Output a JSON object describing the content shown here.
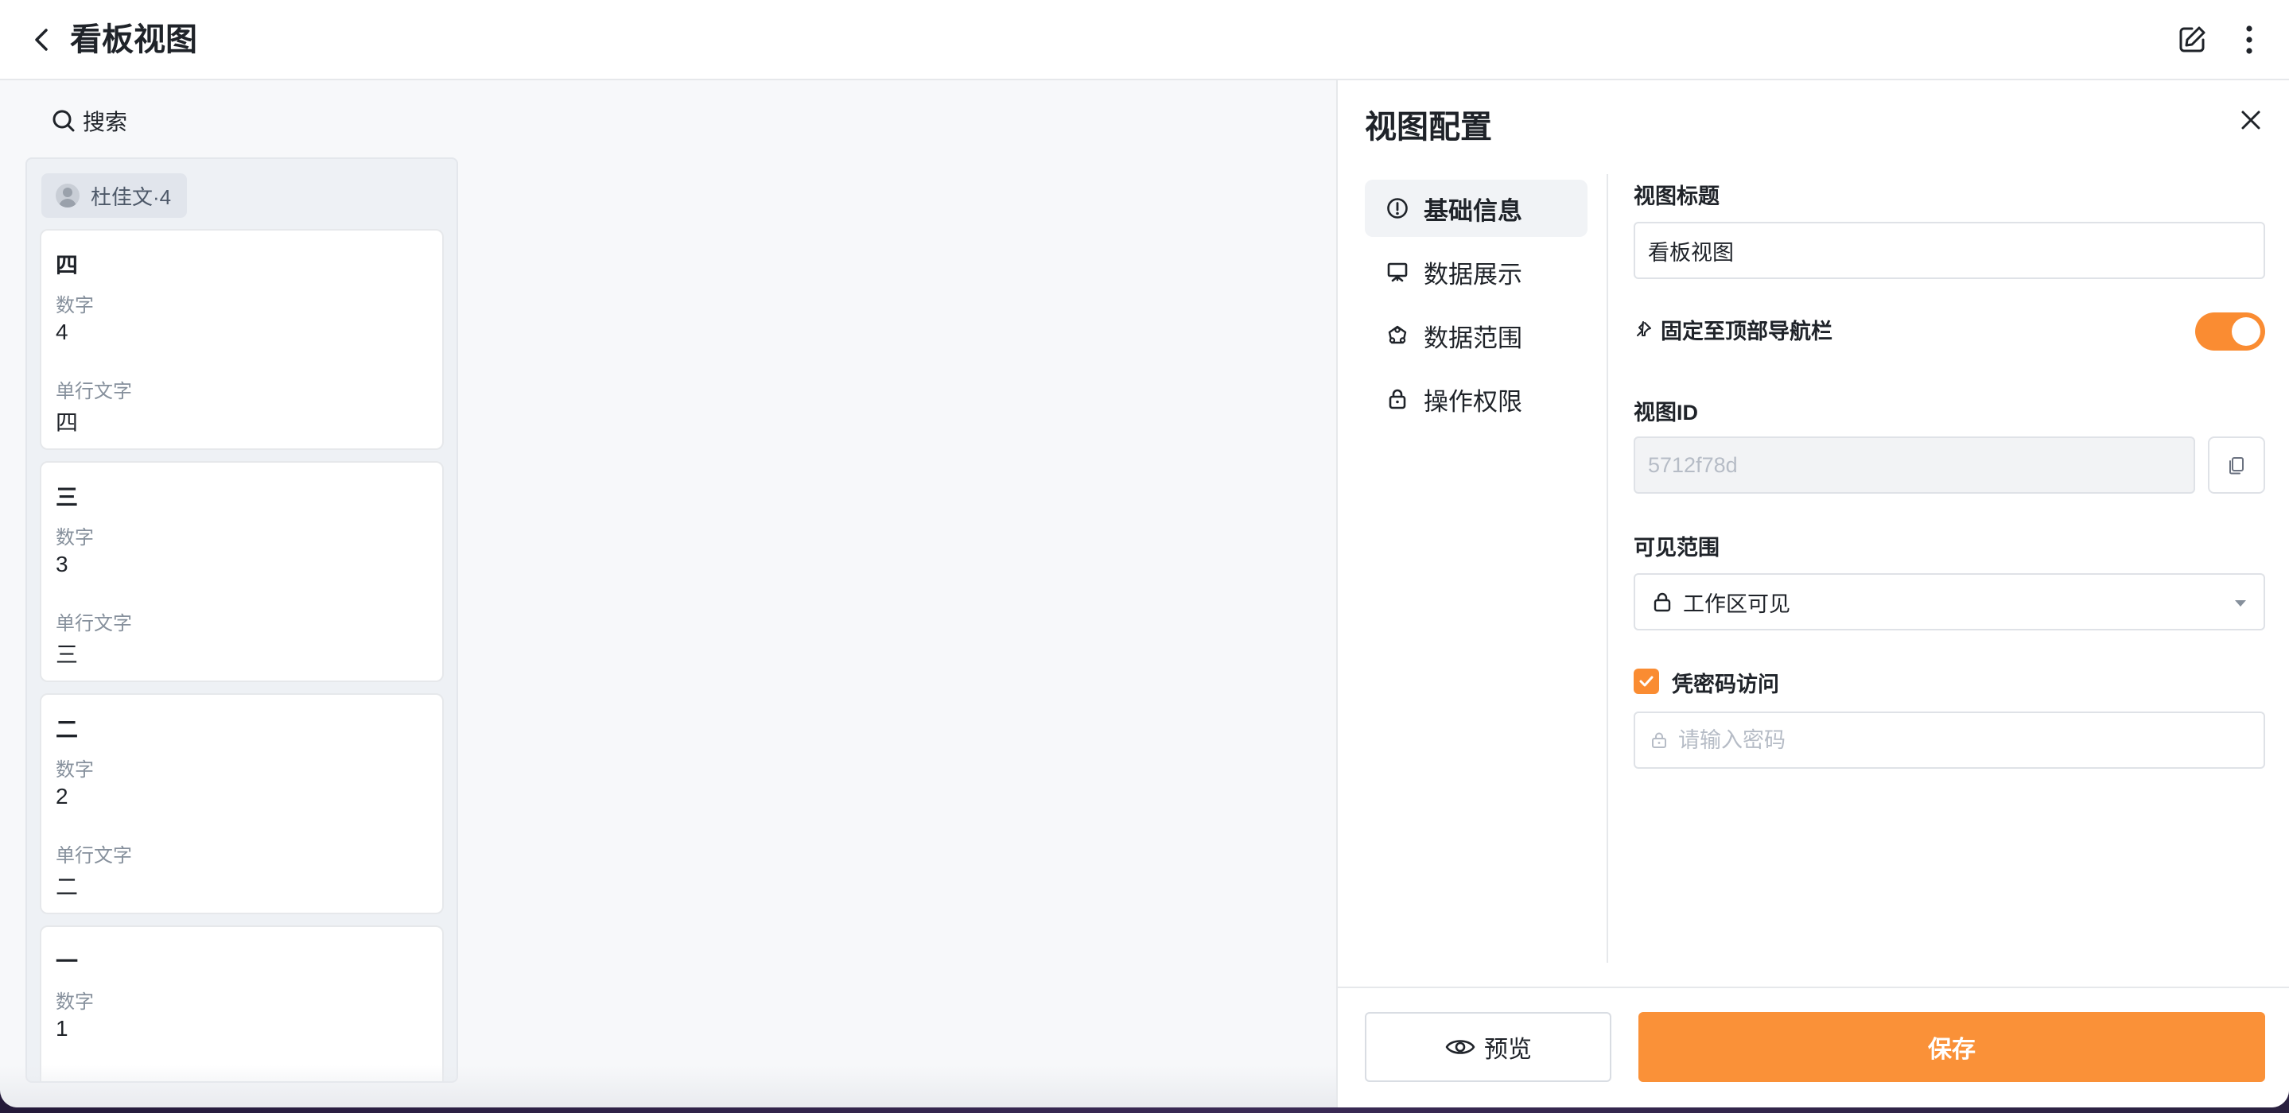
{
  "header": {
    "title": "看板视图",
    "back_icon": "chevron-left-icon",
    "edit_icon": "edit-icon",
    "more_icon": "more-vertical-icon"
  },
  "board": {
    "search_label": "搜索",
    "group": {
      "name": "杜佳文·4"
    },
    "cards": [
      {
        "title": "四",
        "fields": [
          {
            "label": "数字",
            "value": "4"
          },
          {
            "label": "单行文字",
            "value": "四"
          }
        ]
      },
      {
        "title": "三",
        "fields": [
          {
            "label": "数字",
            "value": "3"
          },
          {
            "label": "单行文字",
            "value": "三"
          }
        ]
      },
      {
        "title": "二",
        "fields": [
          {
            "label": "数字",
            "value": "2"
          },
          {
            "label": "单行文字",
            "value": "二"
          }
        ]
      },
      {
        "title": "一",
        "fields": [
          {
            "label": "数字",
            "value": "1"
          }
        ]
      }
    ]
  },
  "drawer": {
    "title": "视图配置",
    "nav": [
      {
        "label": "基础信息",
        "icon": "info-icon",
        "active": true
      },
      {
        "label": "数据展示",
        "icon": "presentation-icon",
        "active": false
      },
      {
        "label": "数据范围",
        "icon": "data-scope-icon",
        "active": false
      },
      {
        "label": "操作权限",
        "icon": "lock-icon",
        "active": false
      }
    ],
    "form": {
      "view_title_label": "视图标题",
      "view_title_value": "看板视图",
      "pin_label": "固定至顶部导航栏",
      "pin_enabled": true,
      "view_id_label": "视图ID",
      "view_id_value": "5712f78d",
      "visibility_label": "可见范围",
      "visibility_value": "工作区可见",
      "password_label": "凭密码访问",
      "password_enabled": true,
      "password_placeholder": "请输入密码"
    },
    "footer": {
      "preview_label": "预览",
      "save_label": "保存"
    }
  },
  "colors": {
    "accent": "#fa8c32",
    "text": "#1f2329",
    "muted": "#86909c",
    "border": "#dfe2e7"
  }
}
